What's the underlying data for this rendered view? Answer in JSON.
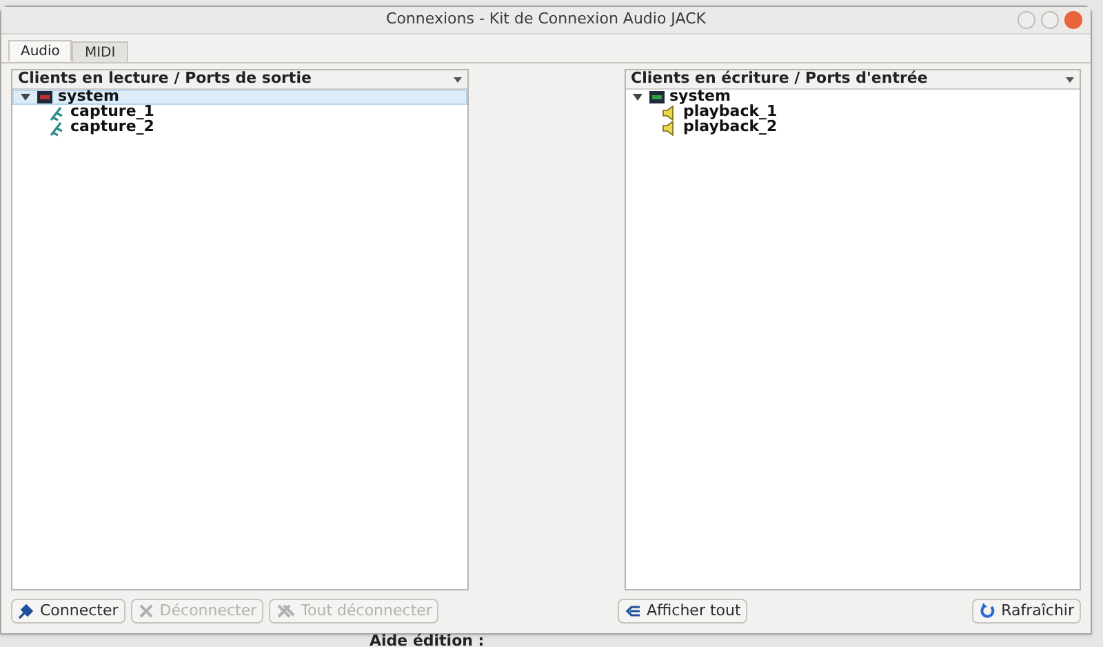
{
  "window": {
    "title": "Connexions - Kit de Connexion Audio JACK"
  },
  "tabs": [
    {
      "label": "Audio",
      "selected": true
    },
    {
      "label": "MIDI",
      "selected": false
    }
  ],
  "panels": [
    {
      "kind": "output",
      "header": "Clients en lecture / Ports de sortie",
      "clients": [
        {
          "name": "system",
          "expanded": true,
          "selected": true,
          "ports": [
            "capture_1",
            "capture_2"
          ]
        }
      ]
    },
    {
      "kind": "input",
      "header": "Clients en écriture / Ports d'entrée",
      "clients": [
        {
          "name": "system",
          "expanded": true,
          "selected": false,
          "ports": [
            "playback_1",
            "playback_2"
          ]
        }
      ]
    }
  ],
  "left_buttons": [
    {
      "kind": "connect",
      "label": "Connecter",
      "disabled": false
    },
    {
      "kind": "disconnect",
      "label": "Déconnecter",
      "disabled": true
    },
    {
      "kind": "disconnect_all",
      "label": "Tout déconnecter",
      "disabled": true
    }
  ],
  "right_buttons": [
    {
      "kind": "show_all",
      "label": "Afficher tout",
      "disabled": false
    },
    {
      "kind": "refresh",
      "label": "Rafraîchir",
      "disabled": false
    }
  ],
  "background": {
    "label": "Aide édition :"
  }
}
